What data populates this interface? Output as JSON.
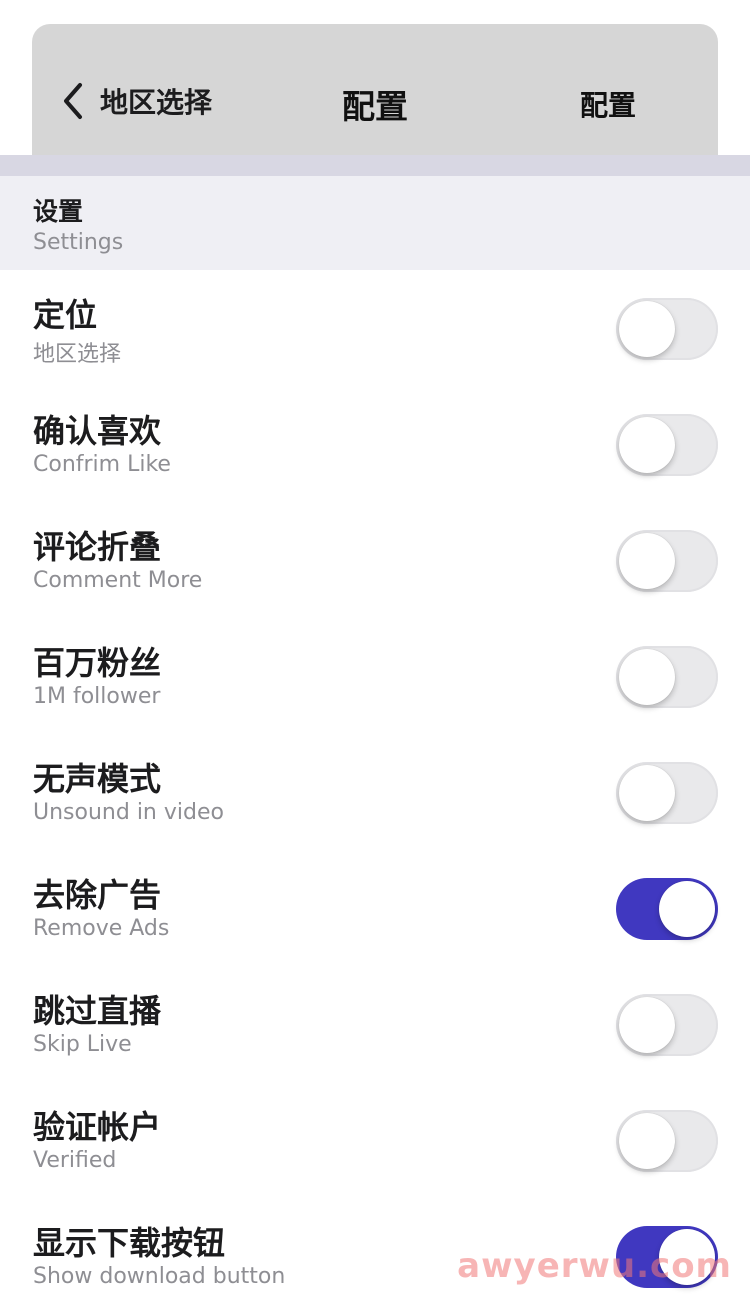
{
  "navbar": {
    "back_label": "地区选择",
    "title": "配置",
    "right_action": "配置"
  },
  "section": {
    "title": "设置",
    "subtitle": "Settings"
  },
  "settings": [
    {
      "title": "定位",
      "subtitle": "地区选择",
      "enabled": false
    },
    {
      "title": "确认喜欢",
      "subtitle": "Confrim Like",
      "enabled": false
    },
    {
      "title": "评论折叠",
      "subtitle": "Comment More",
      "enabled": false
    },
    {
      "title": "百万粉丝",
      "subtitle": "1M follower",
      "enabled": false
    },
    {
      "title": "无声模式",
      "subtitle": "Unsound in video",
      "enabled": false
    },
    {
      "title": "去除广告",
      "subtitle": "Remove Ads",
      "enabled": true
    },
    {
      "title": "跳过直播",
      "subtitle": "Skip Live",
      "enabled": false
    },
    {
      "title": "验证帐户",
      "subtitle": "Verified",
      "enabled": false
    },
    {
      "title": "显示下载按钮",
      "subtitle": "Show download button",
      "enabled": true
    }
  ],
  "icons": {
    "back": "chevron-left-icon"
  },
  "colors": {
    "toggle_on": "#4038c0",
    "toggle_off": "#e9e9eb",
    "navbar_bg": "#d6d6d6",
    "section_bg": "#efeff4"
  },
  "watermark": "awyerwu.com"
}
